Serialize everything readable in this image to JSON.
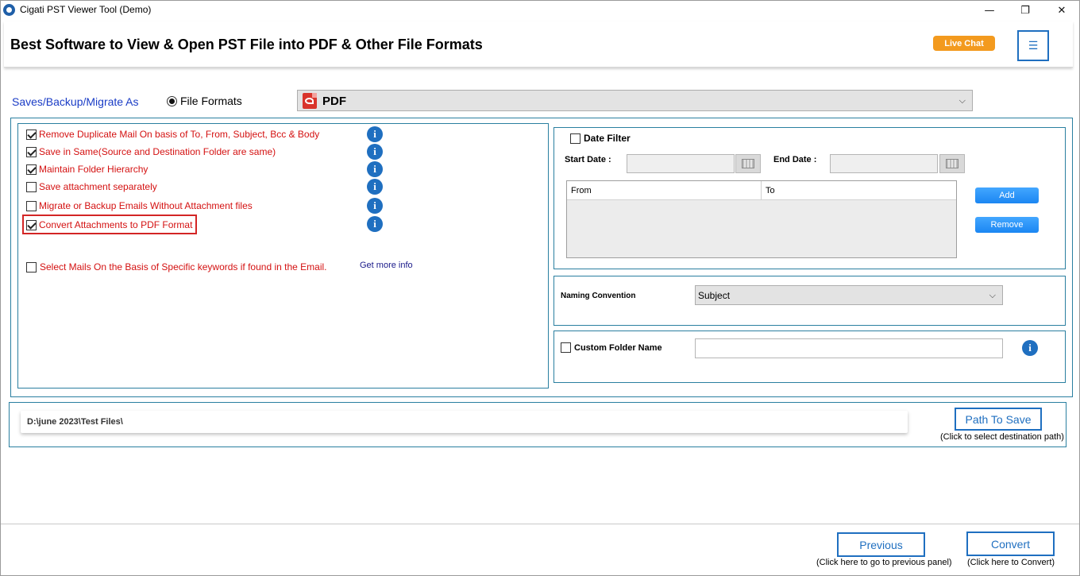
{
  "window": {
    "title": "Cigati PST Viewer Tool (Demo)",
    "minimize": "—",
    "maximize": "❐",
    "close": "✕"
  },
  "header": {
    "title": "Best Software to View & Open PST File into PDF & Other File Formats",
    "live_chat": "Live Chat",
    "menu_icon": "☰"
  },
  "saves": {
    "label": "Saves/Backup/Migrate As",
    "radio_label": "File Formats",
    "selected_format": "PDF"
  },
  "options": [
    {
      "label": "Remove Duplicate Mail On basis of To, From, Subject, Bcc & Body",
      "checked": true
    },
    {
      "label": "Save in Same(Source and Destination Folder are same)",
      "checked": true
    },
    {
      "label": "Maintain Folder Hierarchy",
      "checked": true
    },
    {
      "label": "Save attachment separately",
      "checked": false
    },
    {
      "label": "Migrate or Backup Emails Without Attachment files",
      "checked": false
    },
    {
      "label": "Convert Attachments to PDF Format",
      "checked": true
    }
  ],
  "keywords": {
    "label": "Select Mails On the Basis of Specific keywords if found in the Email.",
    "checked": false,
    "more_info": "Get more info"
  },
  "date_filter": {
    "label": "Date Filter",
    "checked": false,
    "start_label": "Start Date :",
    "end_label": "End Date :",
    "start_value": "",
    "end_value": "",
    "table_headers": [
      "From",
      "To"
    ],
    "add": "Add",
    "remove": "Remove"
  },
  "naming": {
    "label": "Naming Convention",
    "value": "Subject"
  },
  "custom_folder": {
    "label": "Custom Folder Name",
    "checked": false,
    "value": ""
  },
  "path": {
    "value": "D:\\june 2023\\Test Files\\",
    "button": "Path To Save",
    "hint": "(Click to select destination path)"
  },
  "footer": {
    "previous": "Previous",
    "previous_hint": "(Click here to go to previous panel)",
    "convert": "Convert",
    "convert_hint": "(Click here to Convert)"
  },
  "colors": {
    "accent": "#1f6fc0",
    "option_text": "#d41111",
    "live_chat": "#f39a1e",
    "panel_border": "#2a7fa0",
    "highlight": "#d32525"
  },
  "icons": {
    "info": "i",
    "chevron": "⌵"
  }
}
